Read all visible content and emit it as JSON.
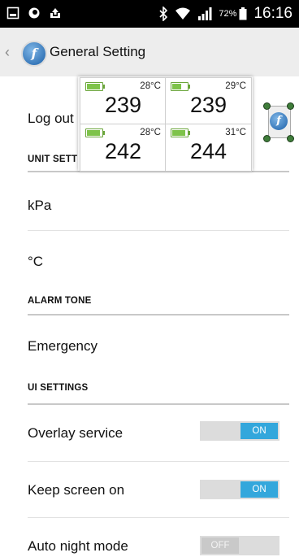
{
  "status_bar": {
    "battery": "72%",
    "time": "16:16"
  },
  "app_bar": {
    "title": "General Setting",
    "logo_glyph": "f"
  },
  "overlay": {
    "tiles": [
      {
        "temperature": "28°C",
        "pressure": "239",
        "battery_level": 1.0
      },
      {
        "temperature": "29°C",
        "pressure": "239",
        "battery_level": 0.7
      },
      {
        "temperature": "28°C",
        "pressure": "242",
        "battery_level": 1.0
      },
      {
        "temperature": "31°C",
        "pressure": "244",
        "battery_level": 1.0
      }
    ],
    "widget_logo_glyph": "f"
  },
  "settings": {
    "logout_label": "Log out",
    "unit_section": "UNIT SETTINGS",
    "pressure_unit": "kPa",
    "temperature_unit": "°C",
    "alarm_section": "ALARM TONE",
    "alarm_tone": "Emergency",
    "ui_section": "UI SETTINGS",
    "overlay_service": {
      "label": "Overlay service",
      "state": "ON"
    },
    "keep_screen_on": {
      "label": "Keep screen on",
      "state": "ON"
    },
    "auto_night_mode": {
      "label": "Auto night mode",
      "state": "OFF"
    }
  },
  "colors": {
    "accent": "#33a7dc",
    "status_bar": "#000000",
    "app_bar": "#ededed",
    "battery_green": "#7ec34a"
  }
}
